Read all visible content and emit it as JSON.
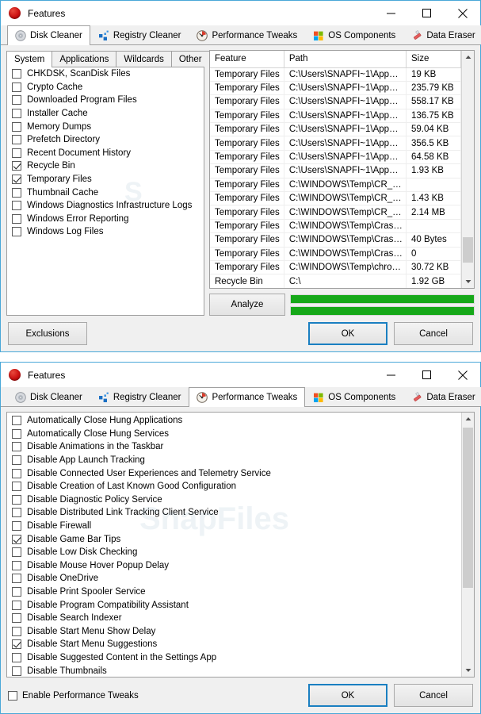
{
  "window_top": {
    "title": "Features",
    "app_icon": "red-circle-icon",
    "controls": {
      "minimize": "minimize-icon",
      "maximize": "maximize-icon",
      "close": "close-icon"
    },
    "tabs": [
      {
        "label": "Disk Cleaner",
        "icon": "disc-icon",
        "active": true
      },
      {
        "label": "Registry Cleaner",
        "icon": "registry-blocks-icon",
        "active": false
      },
      {
        "label": "Performance Tweaks",
        "icon": "gauge-icon",
        "active": false
      },
      {
        "label": "OS Components",
        "icon": "windows-logo-icon",
        "active": false
      },
      {
        "label": "Data Eraser",
        "icon": "eraser-icon",
        "active": false
      }
    ],
    "subtabs": [
      {
        "label": "System",
        "active": true
      },
      {
        "label": "Applications",
        "active": false
      },
      {
        "label": "Wildcards",
        "active": false
      },
      {
        "label": "Other",
        "active": false
      }
    ],
    "checklist": [
      {
        "label": "CHKDSK, ScanDisk Files",
        "checked": false
      },
      {
        "label": "Crypto Cache",
        "checked": false
      },
      {
        "label": "Downloaded Program Files",
        "checked": false
      },
      {
        "label": "Installer Cache",
        "checked": false
      },
      {
        "label": "Memory Dumps",
        "checked": false
      },
      {
        "label": "Prefetch Directory",
        "checked": false
      },
      {
        "label": "Recent Document History",
        "checked": false
      },
      {
        "label": "Recycle Bin",
        "checked": true
      },
      {
        "label": "Temporary Files",
        "checked": true
      },
      {
        "label": "Thumbnail Cache",
        "checked": false
      },
      {
        "label": "Windows Diagnostics Infrastructure Logs",
        "checked": false
      },
      {
        "label": "Windows Error Reporting",
        "checked": false
      },
      {
        "label": "Windows Log Files",
        "checked": false
      }
    ],
    "table": {
      "columns": [
        "Feature",
        "Path",
        "Size"
      ],
      "rows": [
        [
          "Temporary Files",
          "C:\\Users\\SNAPFI~1\\App…",
          "19 KB"
        ],
        [
          "Temporary Files",
          "C:\\Users\\SNAPFI~1\\App…",
          "235.79 KB"
        ],
        [
          "Temporary Files",
          "C:\\Users\\SNAPFI~1\\App…",
          "558.17 KB"
        ],
        [
          "Temporary Files",
          "C:\\Users\\SNAPFI~1\\App…",
          "136.75 KB"
        ],
        [
          "Temporary Files",
          "C:\\Users\\SNAPFI~1\\App…",
          "59.04 KB"
        ],
        [
          "Temporary Files",
          "C:\\Users\\SNAPFI~1\\App…",
          "356.5 KB"
        ],
        [
          "Temporary Files",
          "C:\\Users\\SNAPFI~1\\App…",
          "64.58 KB"
        ],
        [
          "Temporary Files",
          "C:\\Users\\SNAPFI~1\\App…",
          "1.93 KB"
        ],
        [
          "Temporary Files",
          "C:\\WINDOWS\\Temp\\CR_…",
          ""
        ],
        [
          "Temporary Files",
          "C:\\WINDOWS\\Temp\\CR_…",
          "1.43 KB"
        ],
        [
          "Temporary Files",
          "C:\\WINDOWS\\Temp\\CR_…",
          "2.14 MB"
        ],
        [
          "Temporary Files",
          "C:\\WINDOWS\\Temp\\Cras…",
          ""
        ],
        [
          "Temporary Files",
          "C:\\WINDOWS\\Temp\\Cras…",
          "40 Bytes"
        ],
        [
          "Temporary Files",
          "C:\\WINDOWS\\Temp\\Cras…",
          "0"
        ],
        [
          "Temporary Files",
          "C:\\WINDOWS\\Temp\\chro…",
          "30.72 KB"
        ],
        [
          "Recycle Bin",
          "C:\\",
          "1.92 GB"
        ]
      ]
    },
    "analyze_label": "Analyze",
    "progress": {
      "bar1_percent": 100,
      "bar2_percent": 100,
      "color": "#16a819"
    },
    "footer": {
      "exclusions": "Exclusions",
      "ok": "OK",
      "cancel": "Cancel"
    }
  },
  "window_bottom": {
    "title": "Features",
    "app_icon": "red-circle-icon",
    "controls": {
      "minimize": "minimize-icon",
      "maximize": "maximize-icon",
      "close": "close-icon"
    },
    "tabs": [
      {
        "label": "Disk Cleaner",
        "icon": "disc-icon",
        "active": false
      },
      {
        "label": "Registry Cleaner",
        "icon": "registry-blocks-icon",
        "active": false
      },
      {
        "label": "Performance Tweaks",
        "icon": "gauge-icon",
        "active": true
      },
      {
        "label": "OS Components",
        "icon": "windows-logo-icon",
        "active": false
      },
      {
        "label": "Data Eraser",
        "icon": "eraser-icon",
        "active": false
      }
    ],
    "checklist": [
      {
        "label": "Automatically Close Hung Applications",
        "checked": false
      },
      {
        "label": "Automatically Close Hung Services",
        "checked": false
      },
      {
        "label": "Disable Animations in the Taskbar",
        "checked": false
      },
      {
        "label": "Disable App Launch Tracking",
        "checked": false
      },
      {
        "label": "Disable Connected User Experiences and Telemetry Service",
        "checked": false
      },
      {
        "label": "Disable Creation of Last Known Good Configuration",
        "checked": false
      },
      {
        "label": "Disable Diagnostic Policy Service",
        "checked": false
      },
      {
        "label": "Disable Distributed Link Tracking Client Service",
        "checked": false
      },
      {
        "label": "Disable Firewall",
        "checked": false
      },
      {
        "label": "Disable Game Bar Tips",
        "checked": true
      },
      {
        "label": "Disable Low Disk Checking",
        "checked": false
      },
      {
        "label": "Disable Mouse Hover Popup Delay",
        "checked": false
      },
      {
        "label": "Disable OneDrive",
        "checked": false
      },
      {
        "label": "Disable Print Spooler Service",
        "checked": false
      },
      {
        "label": "Disable Program Compatibility Assistant",
        "checked": false
      },
      {
        "label": "Disable Search Indexer",
        "checked": false
      },
      {
        "label": "Disable Start Menu Show Delay",
        "checked": false
      },
      {
        "label": "Disable Start Menu Suggestions",
        "checked": true
      },
      {
        "label": "Disable Suggested Content in the Settings App",
        "checked": false
      },
      {
        "label": "Disable Thumbnails",
        "checked": false
      }
    ],
    "footer": {
      "enable_label": "Enable Performance Tweaks",
      "enable_checked": false,
      "ok": "OK",
      "cancel": "Cancel"
    }
  },
  "watermark": "SnapFiles"
}
